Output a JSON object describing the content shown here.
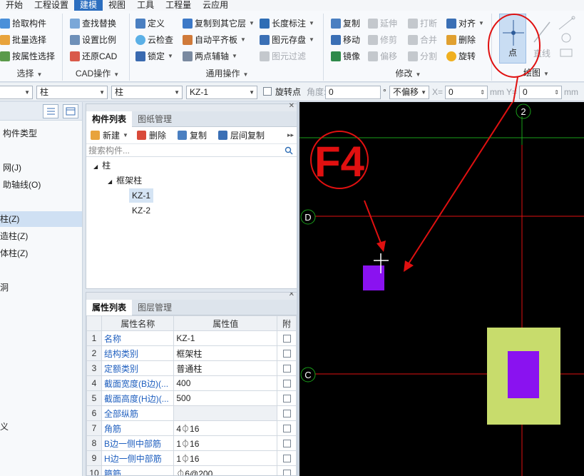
{
  "menu": [
    "开始",
    "工程设置",
    "建模",
    "视图",
    "工具",
    "工程量",
    "云应用"
  ],
  "menu_active": "建模",
  "ribbon": {
    "select_group": {
      "label": "选择",
      "items": [
        "拾取构件",
        "批量选择",
        "按属性选择"
      ]
    },
    "cad_group": {
      "label": "CAD操作",
      "items": [
        "查找替换",
        "设置比例",
        "还原CAD"
      ]
    },
    "common_group": {
      "label": "通用操作",
      "col1": [
        "定义",
        "云检查",
        "锁定"
      ],
      "col2": [
        "复制到其它层",
        "自动平齐板",
        "两点辅轴"
      ],
      "col3": [
        "长度标注",
        "图元存盘",
        "图元过滤"
      ]
    },
    "modify_group": {
      "label": "修改",
      "col1": [
        "复制",
        "移动",
        "镜像"
      ],
      "col2": [
        "延伸",
        "修剪",
        "偏移"
      ],
      "col3": [
        "打断",
        "合并",
        "分割"
      ],
      "col4": [
        "对齐",
        "删除",
        "旋转"
      ]
    },
    "draw_group": {
      "label": "绘图",
      "point": "点",
      "line": "直线"
    }
  },
  "proptool": {
    "combo1": "",
    "combo2": "柱",
    "combo3": "柱",
    "combo4": "KZ-1",
    "rotate_label": "旋转点",
    "angle_label": "角度:",
    "angle_value": "0",
    "offset_combo": "不偏移",
    "x_label": "X=",
    "x_value": "0",
    "unit1": "mm",
    "y_label": "Y=",
    "y_value": "0",
    "unit2": "mm",
    "degree": "°"
  },
  "leftnav": {
    "items": [
      "构件类型",
      "网(J)",
      "助轴线(O)",
      "柱(Z)",
      "造柱(Z)",
      "体柱(Z)",
      "洞",
      "义"
    ]
  },
  "component_panel": {
    "tabs": [
      "构件列表",
      "图纸管理"
    ],
    "actions": {
      "new": "新建",
      "delete": "删除",
      "copy": "复制",
      "floor_copy": "层间复制"
    },
    "search_placeholder": "搜索构件...",
    "tree": {
      "root": "柱",
      "child": "框架柱",
      "leaves": [
        "KZ-1",
        "KZ-2"
      ]
    }
  },
  "property_panel": {
    "tabs": [
      "属性列表",
      "图层管理"
    ],
    "headers": [
      "属性名称",
      "属性值",
      "附"
    ],
    "rows": [
      {
        "n": "1",
        "name": "名称",
        "value": "KZ-1"
      },
      {
        "n": "2",
        "name": "结构类别",
        "value": "框架柱"
      },
      {
        "n": "3",
        "name": "定额类别",
        "value": "普通柱"
      },
      {
        "n": "4",
        "name": "截面宽度(B边)(...",
        "value": "400"
      },
      {
        "n": "5",
        "name": "截面高度(H边)(...",
        "value": "500"
      },
      {
        "n": "6",
        "name": "全部纵筋",
        "value": ""
      },
      {
        "n": "7",
        "name": "角筋",
        "value": "4⏀16"
      },
      {
        "n": "8",
        "name": "B边一侧中部筋",
        "value": "1⏀16"
      },
      {
        "n": "9",
        "name": "H边一侧中部筋",
        "value": "1⏀16"
      },
      {
        "n": "10",
        "name": "箍筋",
        "value": "⏀6@200"
      }
    ]
  },
  "canvas": {
    "axis_labels": [
      "2",
      "D",
      "C"
    ],
    "annotation": "F4",
    "colors": {
      "grid_red": "#e01010",
      "grid_green": "#1aa01a",
      "column_purple": "#8a12f0",
      "column_outer": "#c8dc6c",
      "annotation_red": "#e01010"
    }
  }
}
